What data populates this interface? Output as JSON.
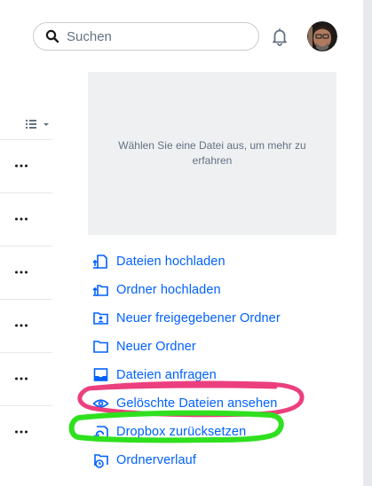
{
  "search": {
    "placeholder": "Suchen"
  },
  "icons": {
    "search": "search-icon",
    "notifications": "bell-icon",
    "avatar": "user-avatar",
    "view": "list-view-icon",
    "more": "more-options-icon"
  },
  "list": {
    "row_count": 6
  },
  "info_panel": {
    "message": "Wählen Sie eine Datei aus, um mehr zu erfahren"
  },
  "actions": [
    {
      "label": "Dateien hochladen",
      "icon": "upload-file-icon"
    },
    {
      "label": "Ordner hochladen",
      "icon": "upload-folder-icon"
    },
    {
      "label": "Neuer freigegebener Ordner",
      "icon": "shared-folder-icon"
    },
    {
      "label": "Neuer Ordner",
      "icon": "folder-icon"
    },
    {
      "label": "Dateien anfragen",
      "icon": "file-request-icon"
    },
    {
      "label": "Gelöschte Dateien ansehen",
      "icon": "eye-icon"
    },
    {
      "label": "Dropbox zurücksetzen",
      "icon": "rewind-icon"
    },
    {
      "label": "Ordnerverlauf",
      "icon": "folder-history-icon"
    }
  ],
  "colors": {
    "link": "#0061fe",
    "muted_text": "#637282",
    "panel_bg": "#eef0f2",
    "highlight_pink": "#ec3f7e",
    "highlight_green": "#2fe01f"
  }
}
